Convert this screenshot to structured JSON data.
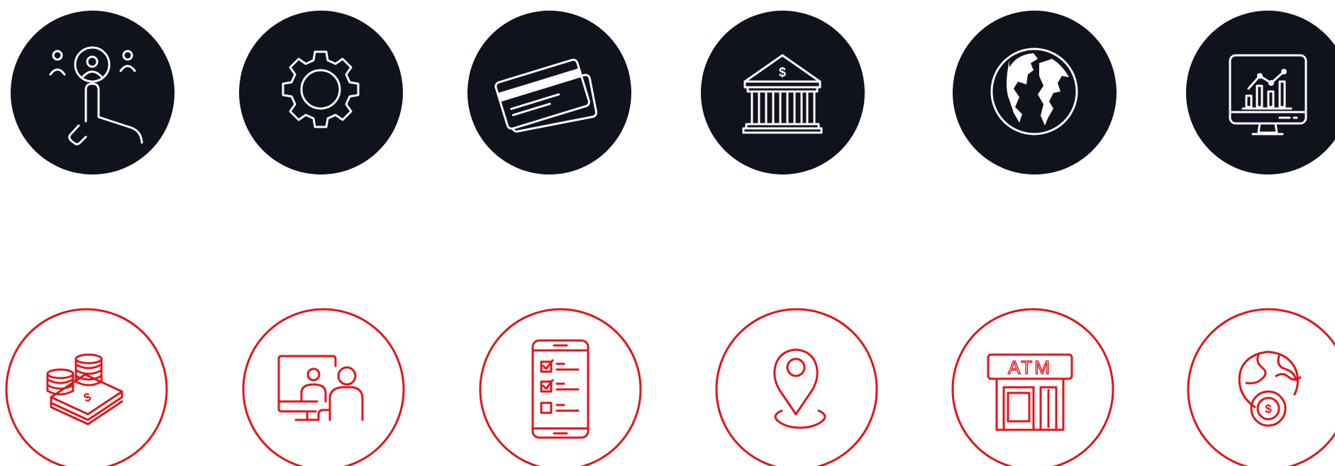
{
  "colors": {
    "dark_fill": "#10121d",
    "accent_red": "#e0141a",
    "icon_white": "#ffffff",
    "background": "#ffffff"
  },
  "rows": {
    "dark": [
      {
        "icon": "user-touch-icon"
      },
      {
        "icon": "gear-icon"
      },
      {
        "icon": "credit-cards-icon"
      },
      {
        "icon": "bank-icon"
      },
      {
        "icon": "globe-icon"
      },
      {
        "icon": "monitor-chart-icon"
      }
    ],
    "outline": [
      {
        "icon": "money-coins-icon"
      },
      {
        "icon": "video-meeting-icon"
      },
      {
        "icon": "mobile-checklist-icon"
      },
      {
        "icon": "location-pin-icon"
      },
      {
        "icon": "atm-icon"
      },
      {
        "icon": "global-currency-icon"
      }
    ]
  },
  "labels": {
    "atm": "ATM",
    "currency_symbol": "$"
  }
}
